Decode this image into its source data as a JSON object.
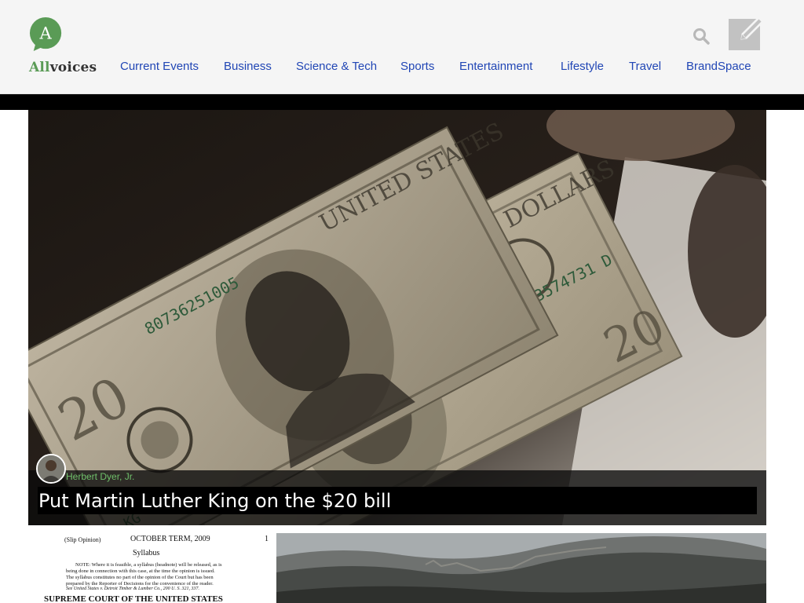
{
  "site": {
    "logo_letter": "A",
    "logo_all": "All",
    "logo_voices": "voices"
  },
  "nav": [
    {
      "label": "Current Events"
    },
    {
      "label": "Business"
    },
    {
      "label": "Science & Tech"
    },
    {
      "label": "Sports"
    },
    {
      "label": "Entertainment"
    },
    {
      "label": "Lifestyle"
    },
    {
      "label": "Travel"
    },
    {
      "label": "BrandSpace"
    }
  ],
  "header_icons": {
    "search": "search-icon",
    "write": "pencil-icon"
  },
  "featured": {
    "author": "Herbert Dyer, Jr.",
    "title": "Put Martin Luther King on the $20 bill",
    "image_icon": "twenty-dollar-bills-photo"
  },
  "cards": {
    "document": {
      "slip": "(Slip Opinion)",
      "term": "OCTOBER TERM, 2009",
      "page": "1",
      "syllabus": "Syllabus",
      "note1": "NOTE: Where it is feasible, a syllabus (headnote) will be released, as is",
      "note2": "being done in connection with this case, at the time the opinion is issued.",
      "note3": "The syllabus constitutes no part of the opinion of the Court but has been",
      "note4": "prepared by the Reporter of Decisions for the convenience of the reader.",
      "note5": "See United States v. Detroit Timber & Lumber Co., 200 U. S. 321, 337.",
      "court": "SUPREME COURT OF THE UNITED STATES"
    },
    "photo": {
      "image_icon": "great-wall-photo"
    }
  },
  "colors": {
    "nav_link": "#2146b5",
    "logo_green": "#5a9b56",
    "author_green": "#6fbf6a",
    "header_bg": "#f5f5f5"
  }
}
